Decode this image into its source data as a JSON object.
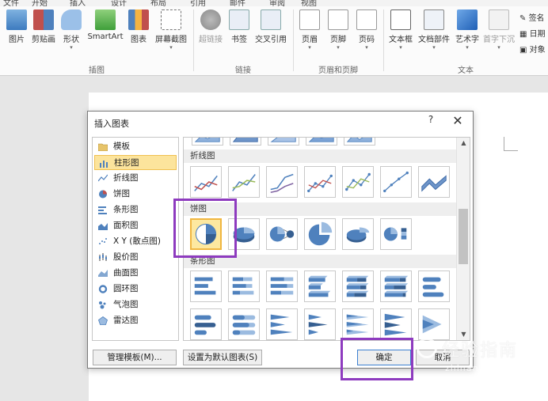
{
  "menubar": [
    "文件",
    "开始",
    "插入",
    "设计",
    "布局",
    "引用",
    "邮件",
    "审阅",
    "视图"
  ],
  "ribbon": {
    "groups": [
      {
        "label": "插图",
        "buttons": [
          "图片",
          "剪贴画",
          "形状",
          "SmartArt",
          "图表",
          "屏幕截图"
        ]
      },
      {
        "label": "链接",
        "buttons": [
          "超链接",
          "书签",
          "交叉引用"
        ]
      },
      {
        "label": "页眉和页脚",
        "buttons": [
          "页眉",
          "页脚",
          "页码"
        ]
      },
      {
        "label": "文本",
        "buttons": [
          "文本框",
          "文档部件",
          "艺术字",
          "首字下沉"
        ]
      }
    ],
    "side_items": [
      "签名",
      "日期",
      "对象"
    ]
  },
  "dialog": {
    "title": "插入图表",
    "help": "?",
    "close": "✕",
    "chart_types": [
      {
        "label": "模板",
        "icon": "folder-icon"
      },
      {
        "label": "柱形图",
        "icon": "column-chart-icon",
        "selected": true
      },
      {
        "label": "折线图",
        "icon": "line-chart-icon"
      },
      {
        "label": "饼图",
        "icon": "pie-chart-icon"
      },
      {
        "label": "条形图",
        "icon": "bar-chart-icon"
      },
      {
        "label": "面积图",
        "icon": "area-chart-icon"
      },
      {
        "label": "X Y (散点图)",
        "icon": "scatter-chart-icon"
      },
      {
        "label": "股价图",
        "icon": "stock-chart-icon"
      },
      {
        "label": "曲面图",
        "icon": "surface-chart-icon"
      },
      {
        "label": "圆环图",
        "icon": "doughnut-chart-icon"
      },
      {
        "label": "气泡图",
        "icon": "bubble-chart-icon"
      },
      {
        "label": "雷达图",
        "icon": "radar-chart-icon"
      }
    ],
    "sections": {
      "line": "折线图",
      "pie": "饼图",
      "bar": "条形图"
    },
    "buttons": {
      "manage_templates": "管理模板(M)...",
      "set_default": "设置为默认图表(S)",
      "ok": "确定",
      "cancel": "取消"
    }
  },
  "watermark": {
    "text": "经验指南",
    "sub": "zhinan.sogou.com"
  },
  "colors": {
    "highlight": "#8e3bbf",
    "selection_fill": "#fde8a0",
    "selection_border": "#f0b640",
    "chart_blue": "#4f81bd"
  }
}
